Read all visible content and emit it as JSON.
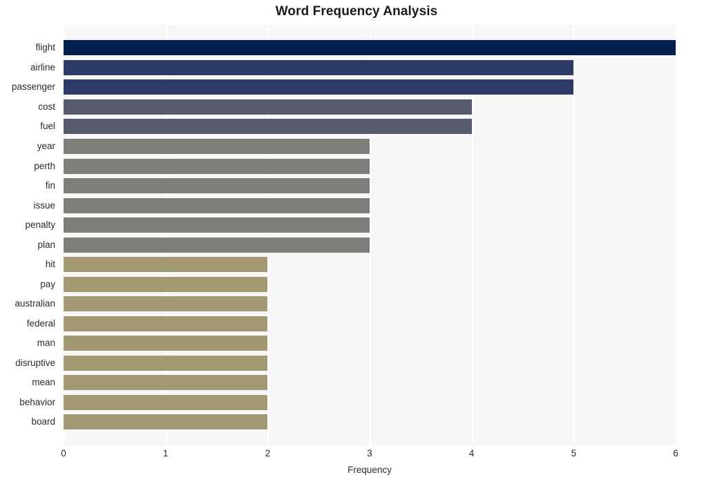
{
  "chart_data": {
    "type": "bar",
    "orientation": "horizontal",
    "title": "Word Frequency Analysis",
    "xlabel": "Frequency",
    "ylabel": "",
    "xlim": [
      0,
      6.0
    ],
    "xticks": [
      0,
      1,
      2,
      3,
      4,
      5,
      6
    ],
    "xticklabels": [
      "0",
      "1",
      "2",
      "3",
      "4",
      "5",
      "6"
    ],
    "grid": true,
    "grid_axis": "x",
    "legend": null,
    "categories": [
      "flight",
      "airline",
      "passenger",
      "cost",
      "fuel",
      "year",
      "perth",
      "fin",
      "issue",
      "penalty",
      "plan",
      "hit",
      "pay",
      "australian",
      "federal",
      "man",
      "disruptive",
      "mean",
      "behavior",
      "board"
    ],
    "values": [
      6,
      5,
      5,
      4,
      4,
      3,
      3,
      3,
      3,
      3,
      3,
      2,
      2,
      2,
      2,
      2,
      2,
      2,
      2,
      2
    ],
    "bar_colors": [
      "#02214c",
      "#2d3b68",
      "#2d3b68",
      "#565b6e",
      "#565b6e",
      "#7d7d7a",
      "#7d7d7a",
      "#7d7d7a",
      "#7d7d7a",
      "#7d7d7a",
      "#7d7d7a",
      "#a39a73",
      "#a39a73",
      "#a39a73",
      "#a39a73",
      "#a39a73",
      "#a39a73",
      "#a39a73",
      "#a39a73",
      "#a39a73"
    ],
    "plot_background": "#f7f7f8",
    "gridline_color": "#ffffff",
    "figure_background": "#ffffff"
  }
}
